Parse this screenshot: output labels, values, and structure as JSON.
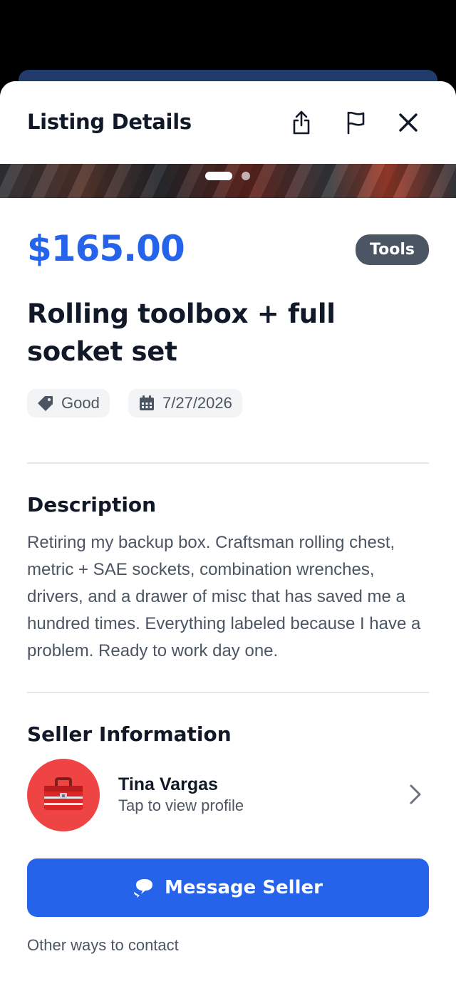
{
  "header": {
    "title": "Listing Details",
    "icons": [
      "share-icon",
      "flag-icon",
      "close-icon"
    ]
  },
  "gallery": {
    "image_count": 2,
    "active_index": 0
  },
  "listing": {
    "price": "$165.00",
    "category": "Tools",
    "title": "Rolling toolbox + full socket set",
    "condition": "Good",
    "date": "7/27/2026"
  },
  "description": {
    "heading": "Description",
    "text": "Retiring my backup box. Craftsman rolling chest, metric + SAE sockets, combination wrenches, drivers, and a drawer of misc that has saved me a hundred times. Everything labeled because I have a problem. Ready to work day one."
  },
  "seller": {
    "heading": "Seller Information",
    "name": "Tina Vargas",
    "subtitle": "Tap to view profile",
    "avatar_icon": "toolbox-icon",
    "avatar_color": "#ef4444"
  },
  "actions": {
    "message_label": "Message Seller",
    "other_contact_label": "Other ways to contact"
  },
  "colors": {
    "accent": "#2563eb",
    "badge": "#4b5563"
  }
}
